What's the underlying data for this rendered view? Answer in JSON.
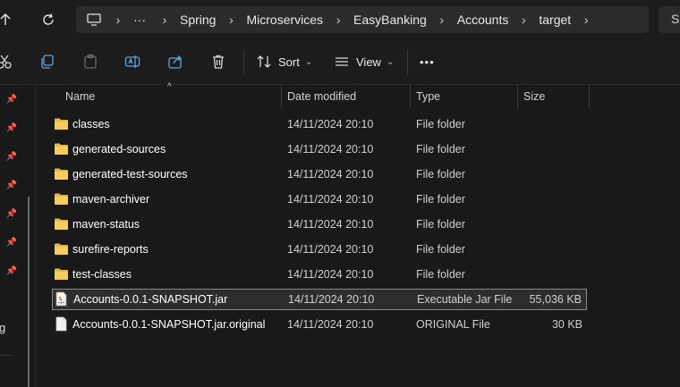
{
  "address": {
    "crumbs": [
      "Spring",
      "Microservices",
      "EasyBanking",
      "Accounts",
      "target"
    ],
    "overflow": "···"
  },
  "search": {
    "placeholder_visible": "Se"
  },
  "toolbar": {
    "sort_label": "Sort",
    "view_label": "View",
    "more_label": "•••"
  },
  "columns": {
    "name": "Name",
    "date": "Date modified",
    "type": "Type",
    "size": "Size"
  },
  "files": [
    {
      "name": "classes",
      "date": "14/11/2024 20:10",
      "type": "File folder",
      "size": "",
      "icon": "folder-icon"
    },
    {
      "name": "generated-sources",
      "date": "14/11/2024 20:10",
      "type": "File folder",
      "size": "",
      "icon": "folder-icon"
    },
    {
      "name": "generated-test-sources",
      "date": "14/11/2024 20:10",
      "type": "File folder",
      "size": "",
      "icon": "folder-icon"
    },
    {
      "name": "maven-archiver",
      "date": "14/11/2024 20:10",
      "type": "File folder",
      "size": "",
      "icon": "folder-icon"
    },
    {
      "name": "maven-status",
      "date": "14/11/2024 20:10",
      "type": "File folder",
      "size": "",
      "icon": "folder-icon"
    },
    {
      "name": "surefire-reports",
      "date": "14/11/2024 20:10",
      "type": "File folder",
      "size": "",
      "icon": "folder-icon"
    },
    {
      "name": "test-classes",
      "date": "14/11/2024 20:10",
      "type": "File folder",
      "size": "",
      "icon": "folder-icon"
    },
    {
      "name": "Accounts-0.0.1-SNAPSHOT.jar",
      "date": "14/11/2024 20:10",
      "type": "Executable Jar File",
      "size": "55,036 KB",
      "icon": "jar-file-icon",
      "selected": true
    },
    {
      "name": "Accounts-0.0.1-SNAPSHOT.jar.original",
      "date": "14/11/2024 20:10",
      "type": "ORIGINAL File",
      "size": "30 KB",
      "icon": "file-icon"
    }
  ],
  "sidebar": {
    "partial_label": "g"
  }
}
